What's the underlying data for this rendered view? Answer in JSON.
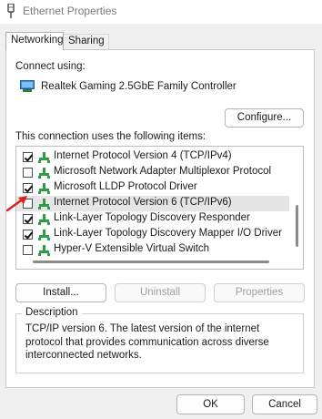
{
  "window": {
    "title": "Ethernet Properties"
  },
  "tabs": [
    {
      "label": "Networking",
      "active": true
    },
    {
      "label": "Sharing",
      "active": false
    }
  ],
  "networking": {
    "connect_using_label": "Connect using:",
    "adapter_name": "Realtek Gaming 2.5GbE Family Controller",
    "configure_button": "Configure...",
    "items_label": "This connection uses the following items:",
    "items": [
      {
        "label": "Internet Protocol Version 4 (TCP/IPv4)",
        "checked": true,
        "icon": "protocol-icon"
      },
      {
        "label": "Microsoft Network Adapter Multiplexor Protocol",
        "checked": false,
        "icon": "protocol-icon"
      },
      {
        "label": "Microsoft LLDP Protocol Driver",
        "checked": true,
        "icon": "protocol-icon"
      },
      {
        "label": "Internet Protocol Version 6 (TCP/IPv6)",
        "checked": false,
        "icon": "protocol-icon",
        "selected": true
      },
      {
        "label": "Link-Layer Topology Discovery Responder",
        "checked": true,
        "icon": "protocol-icon"
      },
      {
        "label": "Link-Layer Topology Discovery Mapper I/O Driver",
        "checked": true,
        "icon": "protocol-icon"
      },
      {
        "label": "Hyper-V Extensible Virtual Switch",
        "checked": false,
        "icon": "protocol-icon"
      }
    ],
    "install_button": "Install...",
    "uninstall_button": "Uninstall",
    "properties_button": "Properties",
    "description_title": "Description",
    "description_text": "TCP/IP version 6. The latest version of the internet protocol that provides communication across diverse interconnected networks."
  },
  "footer": {
    "ok_button": "OK",
    "cancel_button": "Cancel"
  },
  "colors": {
    "protocol_icon": "#2e9c4a",
    "annotation_arrow": "#e0201c"
  }
}
